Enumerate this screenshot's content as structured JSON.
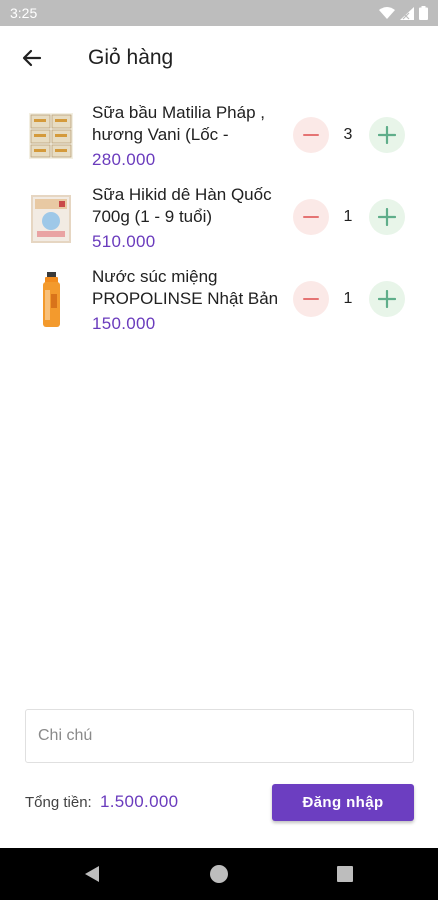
{
  "status_bar": {
    "time": "3:25"
  },
  "header": {
    "title": "Giỏ hàng",
    "back_icon": "arrow-left-icon"
  },
  "cart": {
    "items": [
      {
        "name": "Sữa bầu Matilia Pháp , hương Vani (Lốc -",
        "price": "280.000",
        "quantity": "3"
      },
      {
        "name": "Sữa Hikid dê Hàn Quốc 700g (1 - 9 tuổi)",
        "price": "510.000",
        "quantity": "1"
      },
      {
        "name": "Nước súc miệng PROPOLINSE Nhật Bản",
        "price": "150.000",
        "quantity": "1"
      }
    ]
  },
  "note": {
    "placeholder": "Chi chú",
    "value": ""
  },
  "footer": {
    "total_label": "Tổng tiền:",
    "total_value": "1.500.000",
    "login_label": "Đăng nhập"
  },
  "colors": {
    "accent": "#6c3ec1",
    "price": "#6a3bbd",
    "minus_bg": "#fbe9e7",
    "minus_fg": "#e57373",
    "plus_bg": "#e8f5e9",
    "plus_fg": "#5fae8a"
  },
  "nav_bar": {
    "back_icon": "triangle-back-icon",
    "home_icon": "circle-home-icon",
    "recents_icon": "square-recents-icon"
  }
}
